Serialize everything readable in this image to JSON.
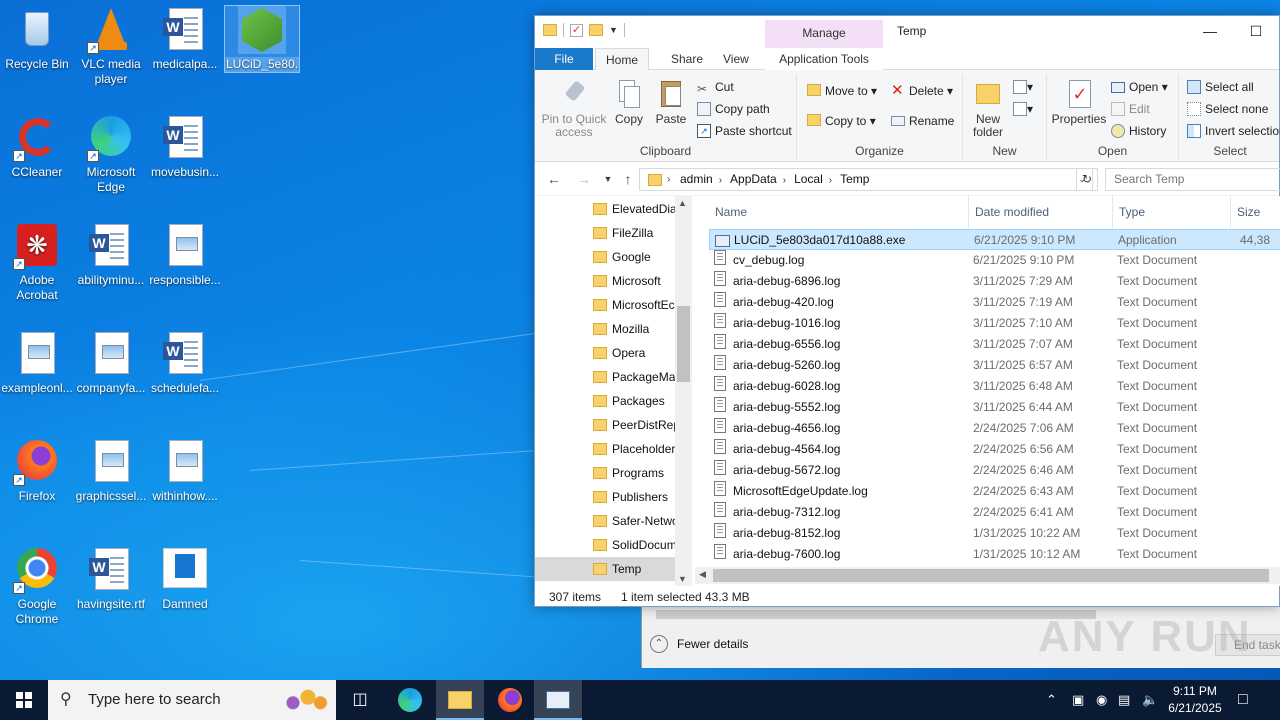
{
  "desktop": {
    "icons": [
      {
        "label": "Recycle Bin",
        "icon": "recycle-bin-icon"
      },
      {
        "label": "VLC media player",
        "icon": "vlc-icon"
      },
      {
        "label": "medicalpa...",
        "icon": "word-doc-icon"
      },
      {
        "label": "LUCiD_5e80...",
        "icon": "green-hexagon-app-icon"
      },
      {
        "label": "CCleaner",
        "icon": "ccleaner-icon"
      },
      {
        "label": "Microsoft Edge",
        "icon": "edge-icon"
      },
      {
        "label": "movebusin...",
        "icon": "word-doc-icon"
      },
      {
        "label": "Adobe Acrobat",
        "icon": "acrobat-icon"
      },
      {
        "label": "abilityminu...",
        "icon": "word-doc-icon"
      },
      {
        "label": "responsible...",
        "icon": "image-file-icon"
      },
      {
        "label": "exampleonl...",
        "icon": "image-file-icon"
      },
      {
        "label": "companyfa...",
        "icon": "image-file-icon"
      },
      {
        "label": "schedulefa...",
        "icon": "word-doc-icon"
      },
      {
        "label": "Firefox",
        "icon": "firefox-icon"
      },
      {
        "label": "graphicssel...",
        "icon": "image-file-icon"
      },
      {
        "label": "withinhow....",
        "icon": "image-file-icon"
      },
      {
        "label": "Google Chrome",
        "icon": "chrome-icon"
      },
      {
        "label": "havingsite.rtf",
        "icon": "word-doc-icon"
      },
      {
        "label": "Damned",
        "icon": "blue-square-icon"
      }
    ]
  },
  "explorer": {
    "manage_tab": "Manage",
    "title": "Temp",
    "tabs": {
      "file": "File",
      "home": "Home",
      "share": "Share",
      "view": "View",
      "app_tools": "Application Tools"
    },
    "ribbon": {
      "clipboard": {
        "title": "Clipboard",
        "pin": "Pin to Quick access",
        "copy": "Copy",
        "paste": "Paste",
        "cut": "Cut",
        "copy_path": "Copy path",
        "paste_shortcut": "Paste shortcut"
      },
      "organize": {
        "title": "Organize",
        "move_to": "Move to",
        "copy_to": "Copy to",
        "delete": "Delete",
        "rename": "Rename"
      },
      "new": {
        "title": "New",
        "new_folder": "New folder"
      },
      "open": {
        "title": "Open",
        "properties": "Properties",
        "open": "Open",
        "edit": "Edit",
        "history": "History"
      },
      "select": {
        "title": "Select",
        "select_all": "Select all",
        "select_none": "Select none",
        "invert": "Invert selection"
      }
    },
    "address": {
      "crumbs": [
        "admin",
        "AppData",
        "Local",
        "Temp"
      ],
      "search_placeholder": "Search Temp"
    },
    "nav_items": [
      "ElevatedDia",
      "FileZilla",
      "Google",
      "Microsoft",
      "MicrosoftEc",
      "Mozilla",
      "Opera",
      "PackageMa",
      "Packages",
      "PeerDistRep",
      "Placeholder",
      "Programs",
      "Publishers",
      "Safer-Netwo",
      "SolidDocum",
      "Temp"
    ],
    "columns": {
      "name": "Name",
      "date": "Date modified",
      "type": "Type",
      "size": "Size"
    },
    "files": [
      {
        "name": "LUCiD_5e803da017d10a88.exe",
        "date": "6/21/2025 9:10 PM",
        "type": "Application",
        "size": "44,38"
      },
      {
        "name": "cv_debug.log",
        "date": "6/21/2025 9:10 PM",
        "type": "Text Document",
        "size": ""
      },
      {
        "name": "aria-debug-6896.log",
        "date": "3/11/2025 7:29 AM",
        "type": "Text Document",
        "size": ""
      },
      {
        "name": "aria-debug-420.log",
        "date": "3/11/2025 7:19 AM",
        "type": "Text Document",
        "size": ""
      },
      {
        "name": "aria-debug-1016.log",
        "date": "3/11/2025 7:10 AM",
        "type": "Text Document",
        "size": ""
      },
      {
        "name": "aria-debug-6556.log",
        "date": "3/11/2025 7:07 AM",
        "type": "Text Document",
        "size": ""
      },
      {
        "name": "aria-debug-5260.log",
        "date": "3/11/2025 6:57 AM",
        "type": "Text Document",
        "size": ""
      },
      {
        "name": "aria-debug-6028.log",
        "date": "3/11/2025 6:48 AM",
        "type": "Text Document",
        "size": ""
      },
      {
        "name": "aria-debug-5552.log",
        "date": "3/11/2025 6:44 AM",
        "type": "Text Document",
        "size": ""
      },
      {
        "name": "aria-debug-4656.log",
        "date": "2/24/2025 7:06 AM",
        "type": "Text Document",
        "size": ""
      },
      {
        "name": "aria-debug-4564.log",
        "date": "2/24/2025 6:56 AM",
        "type": "Text Document",
        "size": ""
      },
      {
        "name": "aria-debug-5672.log",
        "date": "2/24/2025 6:46 AM",
        "type": "Text Document",
        "size": ""
      },
      {
        "name": "MicrosoftEdgeUpdate.log",
        "date": "2/24/2025 6:43 AM",
        "type": "Text Document",
        "size": ""
      },
      {
        "name": "aria-debug-7312.log",
        "date": "2/24/2025 6:41 AM",
        "type": "Text Document",
        "size": ""
      },
      {
        "name": "aria-debug-8152.log",
        "date": "1/31/2025 10:22 AM",
        "type": "Text Document",
        "size": ""
      },
      {
        "name": "aria-debug-7600.log",
        "date": "1/31/2025 10:12 AM",
        "type": "Text Document",
        "size": ""
      }
    ],
    "status": {
      "count": "307 items",
      "selected": "1 item selected",
      "size": "43.3 MB"
    }
  },
  "task_manager": {
    "fewer_details": "Fewer details",
    "end_task": "End task"
  },
  "watermark": "ANY RUN",
  "taskbar": {
    "search_placeholder": "Type here to search",
    "time": "9:11 PM",
    "date": "6/21/2025"
  },
  "colors": {
    "accent": "#0078d7",
    "file_tab": "#1979ca",
    "manage_tab": "#f4e0f6",
    "selection": "#cce8ff"
  }
}
